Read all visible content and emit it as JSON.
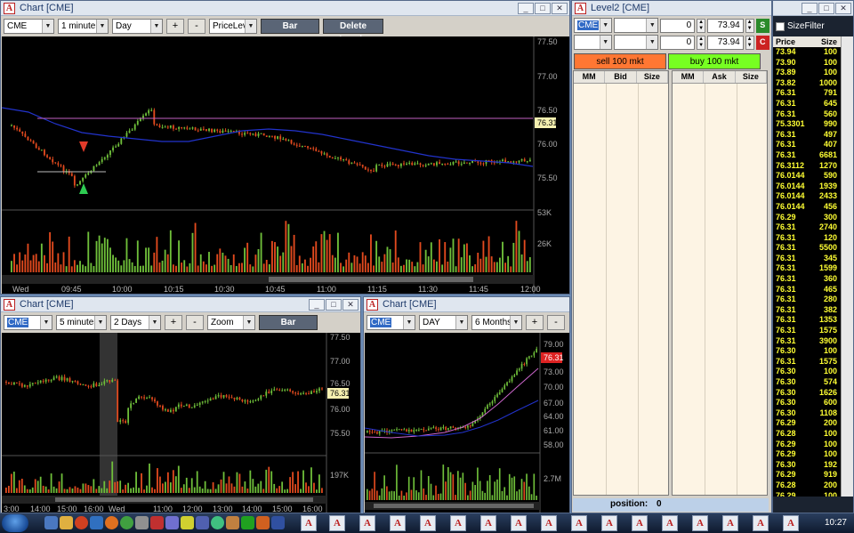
{
  "chart1": {
    "title": "Chart [CME]",
    "symbol": "CME",
    "interval": "1 minute",
    "range": "Day",
    "plus": "+",
    "minus": "-",
    "mode": "PriceLeve",
    "type_btn": "Bar",
    "levels_btn": "Delete Levels",
    "price_ticks": [
      "77.50",
      "77.00",
      "76.50",
      "76.00",
      "75.50"
    ],
    "current_price": "76.31",
    "vol_ticks": [
      "53K",
      "26K"
    ],
    "time_labels": [
      "Wed",
      "09:45",
      "10:00",
      "10:15",
      "10:30",
      "10:45",
      "11:00",
      "11:15",
      "11:30",
      "11:45",
      "12:00"
    ]
  },
  "chart2": {
    "title": "Chart [CME]",
    "symbol": "CME",
    "interval": "5 minutes",
    "range": "2 Days",
    "plus": "+",
    "minus": "-",
    "mode": "Zoom",
    "type_btn": "Bar",
    "price_ticks": [
      "77.50",
      "77.00",
      "76.50",
      "76.00",
      "75.50"
    ],
    "current_price": "76.31",
    "vol_ticks": [
      "197K"
    ],
    "time_labels": [
      "3:00",
      "14:00",
      "15:00",
      "16:00",
      "Wed",
      "11:00",
      "12:00",
      "13:00",
      "14:00",
      "15:00",
      "16:00"
    ]
  },
  "chart3": {
    "title": "Chart [CME]",
    "symbol": "CME",
    "interval": "DAY",
    "range": "6 Months",
    "plus": "+",
    "minus": "-",
    "price_ticks": [
      "79.00",
      "76.00",
      "73.00",
      "70.00",
      "67.00",
      "64.00",
      "61.00",
      "58.00"
    ],
    "current_price": "76.31",
    "vol_ticks": [
      "2.7M"
    ]
  },
  "level2": {
    "title": "Level2 [CME]",
    "symbol": "CME",
    "qty1": "0",
    "price1": "73.94",
    "qty2": "0",
    "price2": "73.94",
    "sell_btn": "sell 100 mkt",
    "buy_btn": "buy 100 mkt",
    "bid_headers": [
      "MM",
      "Bid",
      "Size"
    ],
    "ask_headers": [
      "MM",
      "Ask",
      "Size"
    ],
    "position_label": "position:",
    "position_value": "0",
    "size_filter": "SizeFilter"
  },
  "time_sales": {
    "headers": [
      "Price",
      "Size"
    ],
    "rows": [
      [
        "73.94",
        "100"
      ],
      [
        "73.90",
        "100"
      ],
      [
        "73.89",
        "100"
      ],
      [
        "73.82",
        "1000"
      ],
      [
        "76.31",
        "791"
      ],
      [
        "76.31",
        "645"
      ],
      [
        "76.31",
        "560"
      ],
      [
        "75.3301",
        "990"
      ],
      [
        "76.31",
        "497"
      ],
      [
        "76.31",
        "407"
      ],
      [
        "76.31",
        "6681"
      ],
      [
        "76.3112",
        "1270"
      ],
      [
        "76.0144",
        "590"
      ],
      [
        "76.0144",
        "1939"
      ],
      [
        "76.0144",
        "2433"
      ],
      [
        "76.0144",
        "456"
      ],
      [
        "76.29",
        "300"
      ],
      [
        "76.31",
        "2740"
      ],
      [
        "76.31",
        "120"
      ],
      [
        "76.31",
        "5500"
      ],
      [
        "76.31",
        "345"
      ],
      [
        "76.31",
        "1599"
      ],
      [
        "76.31",
        "360"
      ],
      [
        "76.31",
        "465"
      ],
      [
        "76.31",
        "280"
      ],
      [
        "76.31",
        "382"
      ],
      [
        "76.31",
        "1353"
      ],
      [
        "76.31",
        "1575"
      ],
      [
        "76.31",
        "3900"
      ],
      [
        "76.30",
        "100"
      ],
      [
        "76.31",
        "1575"
      ],
      [
        "76.30",
        "100"
      ],
      [
        "76.30",
        "574"
      ],
      [
        "76.30",
        "1626"
      ],
      [
        "76.30",
        "600"
      ],
      [
        "76.30",
        "1108"
      ],
      [
        "76.29",
        "200"
      ],
      [
        "76.28",
        "100"
      ],
      [
        "76.29",
        "100"
      ],
      [
        "76.29",
        "100"
      ],
      [
        "76.30",
        "192"
      ],
      [
        "76.29",
        "919"
      ],
      [
        "76.28",
        "200"
      ],
      [
        "76.29",
        "100"
      ]
    ],
    "row_colors": [
      "#ffff33",
      "#ffff33",
      "#ffff33",
      "#ffff33",
      "#ffff33",
      "#ffff33",
      "#ffff33",
      "#ffff33",
      "#ffff33",
      "#ffff33",
      "#ffff33",
      "#ffff33",
      "#ffff33",
      "#ffff33",
      "#ffff33",
      "#ffff33",
      "#ffff33",
      "#ffff33",
      "#ffff33",
      "#ffff33",
      "#ffff33",
      "#ffff33",
      "#ffff33",
      "#ffff33",
      "#ffff33",
      "#ffff33",
      "#ffff33",
      "#ffff33",
      "#ffff33",
      "#ffff33",
      "#ffff33",
      "#ffff33",
      "#ffff33",
      "#ffff33",
      "#ffff33",
      "#ffff33",
      "#ffff33",
      "#ffff33",
      "#ffff33",
      "#ffff33",
      "#ffff33",
      "#ffff33",
      "#ffff33",
      "#ffff33"
    ]
  },
  "taskbar": {
    "clock": "10:27"
  },
  "colors": {
    "up": "#6fbf3a",
    "down": "#e24a1e",
    "ma_blue": "#2233cc",
    "ma_pink": "#cc66cc",
    "price_tag": "#f5f0b0"
  }
}
